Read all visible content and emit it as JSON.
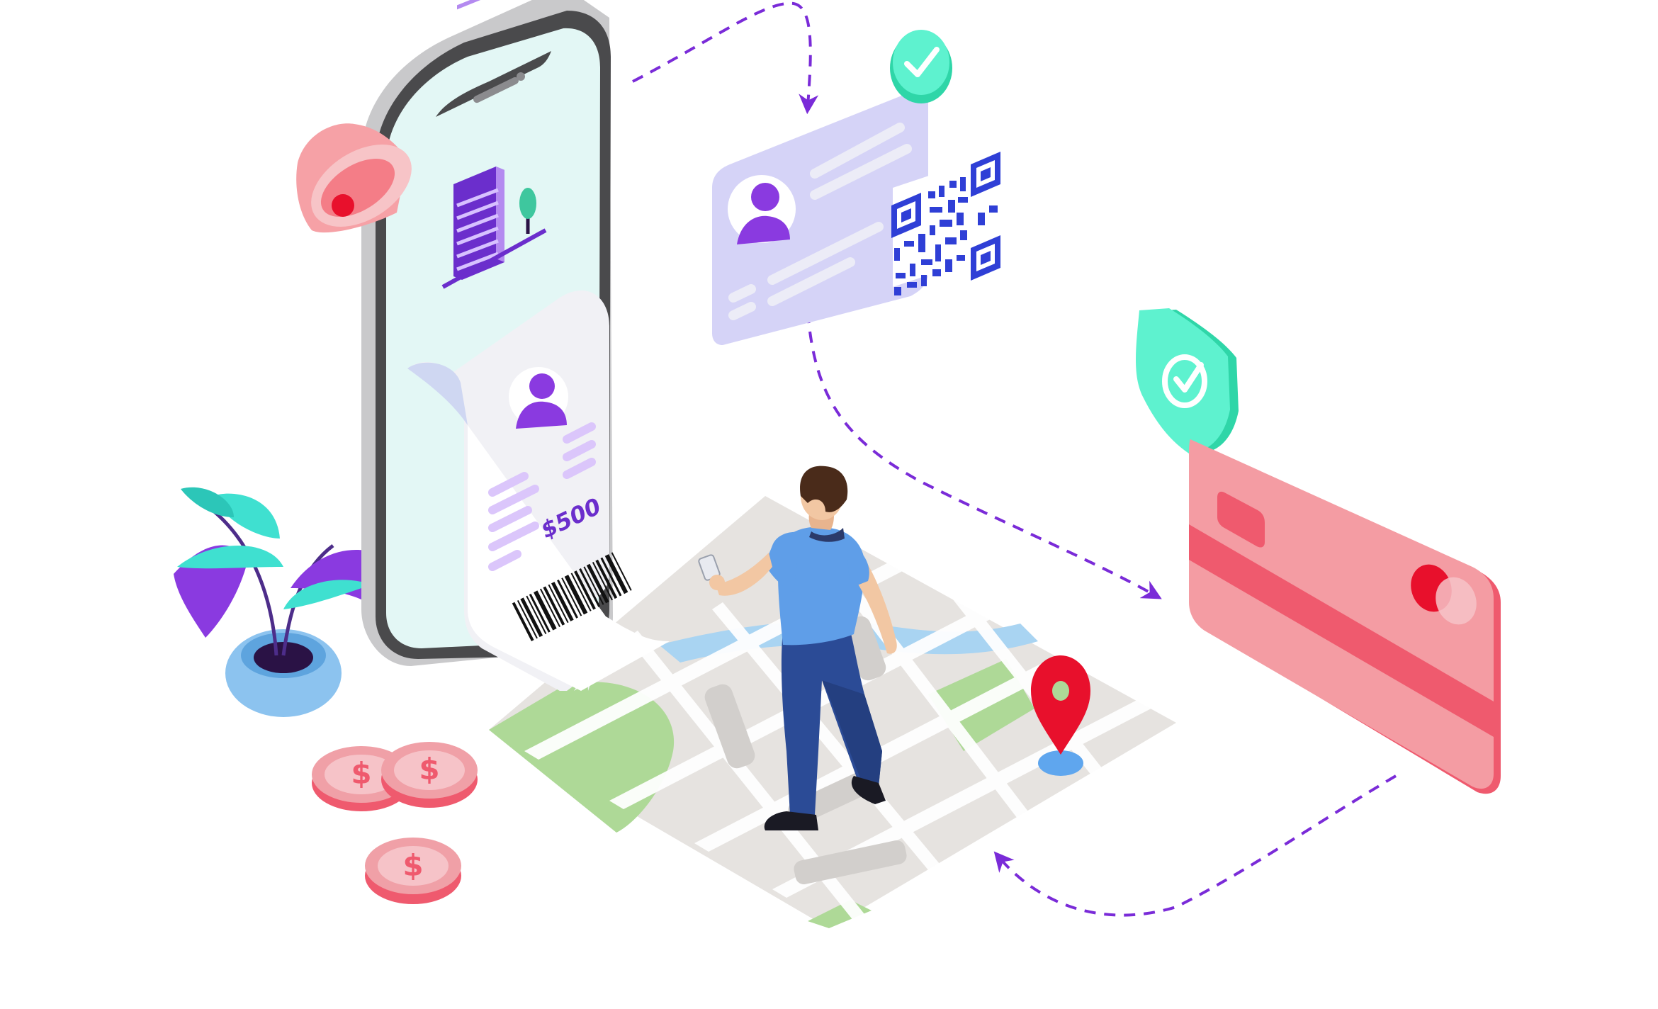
{
  "illustration": {
    "receipt": {
      "amount": "$500"
    },
    "icons": [
      "smartphone-icon",
      "notification-bell-icon",
      "building-icon",
      "receipt-icon",
      "barcode-icon",
      "user-profile-icon",
      "id-card-icon",
      "qr-code-icon",
      "checkmark-badge-icon",
      "security-shield-icon",
      "credit-card-icon",
      "map-icon",
      "location-pin-icon",
      "person-icon",
      "plant-icon",
      "coin-icon",
      "dashed-arrow-icon"
    ]
  },
  "colors": {
    "purple": "#8a3ae0",
    "mint": "#5ef2cf",
    "card_red": "#f49ca3",
    "card_stripe": "#ef5a6e",
    "phone_screen": "#e3f7f5",
    "id_card": "#d5d3f7",
    "qr_blue": "#2f3fd6",
    "map_ground": "#e6e3e0",
    "map_green": "#aed997",
    "river": "#a9d4f2",
    "pin_red": "#e8102c",
    "shirt_blue": "#5f9ee8",
    "pants_blue": "#2b4b96",
    "plant_teal": "#3fe0d0",
    "pot_blue": "#8cc3ef",
    "bell_pink": "#f6a1a6",
    "coin_pink": "#f0a0a7"
  }
}
